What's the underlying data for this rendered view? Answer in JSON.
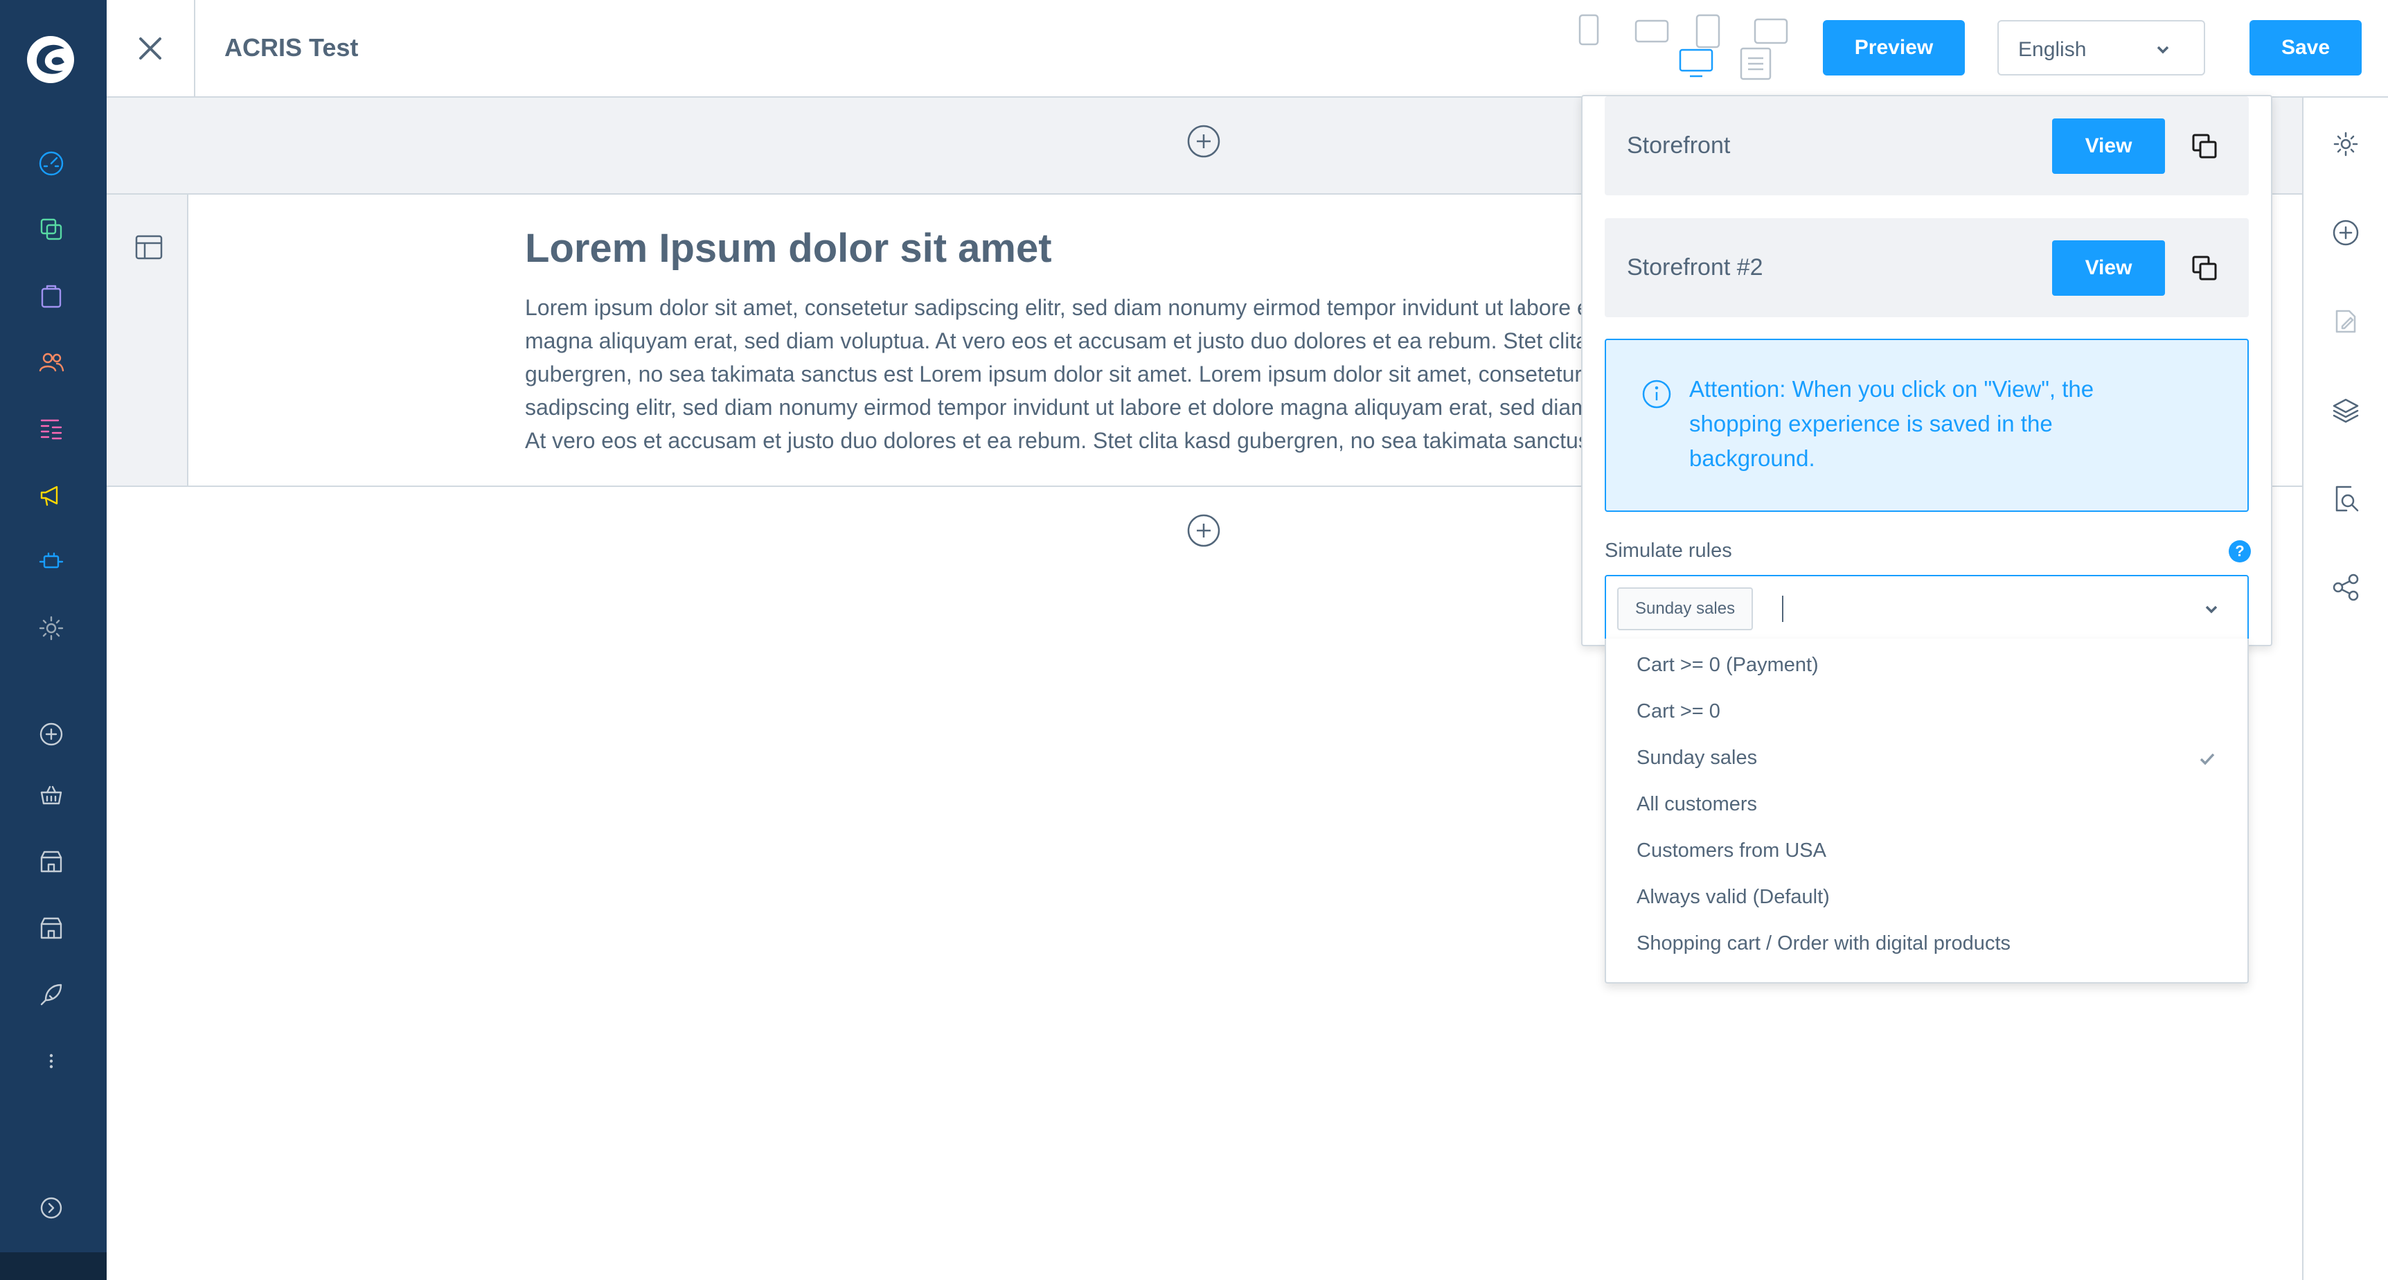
{
  "app": {
    "title": "ACRIS Test",
    "accent_color": "#189eff",
    "nav_color": "#1b3b5f"
  },
  "admin_nav": {
    "icons": [
      "shopware-logo",
      "dashboard-icon",
      "catalogue-icon",
      "orders-icon",
      "customers-icon",
      "content-icon",
      "marketing-icon",
      "extensions-icon",
      "settings-icon",
      "add-sales-channel-icon",
      "basket-icon",
      "storefront-icon",
      "storefront-icon",
      "rocket-icon",
      "more-icon",
      "expand-icon"
    ]
  },
  "toolbar": {
    "devices": [
      "mobile",
      "tablet-landscape",
      "tablet-portrait",
      "landscape",
      "desktop",
      "form"
    ],
    "preview_label": "Preview",
    "language": "English",
    "save_label": "Save"
  },
  "block": {
    "title": "Lorem Ipsum dolor sit amet",
    "text": "Lorem ipsum dolor sit amet, consetetur sadipscing elitr, sed diam nonumy eirmod tempor invidunt ut labore et dolore magna aliquyam erat, sed diam voluptua. At vero eos et accusam et justo duo dolores et ea rebum. Stet clita kasd gubergren, no sea takimata sanctus est Lorem ipsum dolor sit amet. Lorem ipsum dolor sit amet, consetetur sadipscing elitr, sed diam nonumy eirmod tempor invidunt ut labore et dolore magna aliquyam erat, sed diam voluptua. At vero eos et accusam et justo duo dolores et ea rebum. Stet clita kasd gubergren, no sea takimata sanctus est Lorem ipsum dolor sit amet."
  },
  "preview_panel": {
    "storefronts": [
      {
        "name": "Storefront",
        "view_label": "View"
      },
      {
        "name": "Storefront #2",
        "view_label": "View"
      }
    ],
    "attention": "Attention: When you click on \"View\", the shopping experience is saved in the background.",
    "simulate_label": "Simulate rules",
    "help": "?",
    "selected_rule": "Sunday sales",
    "rules": [
      {
        "label": "Cart >= 0 (Payment)",
        "selected": false
      },
      {
        "label": "Cart >= 0",
        "selected": false
      },
      {
        "label": "Sunday sales",
        "selected": true
      },
      {
        "label": "All customers",
        "selected": false
      },
      {
        "label": "Customers from USA",
        "selected": false
      },
      {
        "label": "Always valid (Default)",
        "selected": false
      },
      {
        "label": "Shopping cart / Order with digital products",
        "selected": false
      }
    ]
  },
  "right_sidebar": {
    "icons": [
      "settings-icon",
      "add-block-icon",
      "edit-icon",
      "layers-icon",
      "preview-search-icon",
      "share-icon"
    ]
  }
}
